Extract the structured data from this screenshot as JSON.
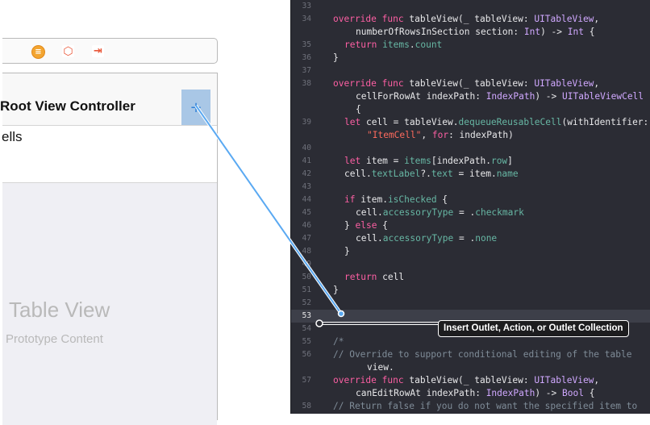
{
  "storyboard": {
    "dock_icons": [
      "view-controller-icon",
      "first-responder-icon",
      "exit-icon"
    ],
    "nav_title": "Root View Controller",
    "add_button_icon": "plus-icon",
    "section_label": "ells",
    "table_view_label": "Table View",
    "prototype_label": "Prototype Content"
  },
  "tooltip": "Insert Outlet, Action, or Outlet Collection",
  "colors": {
    "editor_background": "#2b2c34",
    "keyword": "#fc5fa3",
    "type": "#d0a8ff",
    "property": "#67b7a4",
    "string": "#fc6a5d",
    "comment": "#7f8c98",
    "connection_line": "#5aa9f2",
    "add_button_selected": "#a9c7e6"
  },
  "editor": {
    "current_line": "53",
    "lines": [
      {
        "n": "33",
        "t": ""
      },
      {
        "n": "34",
        "t": "override func tableView(_ tableView: UITableView,"
      },
      {
        "n": "",
        "t": "numberOfRowsInSection section: Int) -> Int {"
      },
      {
        "n": "35",
        "t": "return items.count"
      },
      {
        "n": "36",
        "t": "}"
      },
      {
        "n": "37",
        "t": ""
      },
      {
        "n": "38",
        "t": "override func tableView(_ tableView: UITableView,"
      },
      {
        "n": "",
        "t": "cellForRowAt indexPath: IndexPath) -> UITableViewCell"
      },
      {
        "n": "",
        "t": "{"
      },
      {
        "n": "39",
        "t": "let cell = tableView.dequeueReusableCell(withIdentifier:"
      },
      {
        "n": "",
        "t": "\"ItemCell\", for: indexPath)"
      },
      {
        "n": "40",
        "t": ""
      },
      {
        "n": "41",
        "t": "let item = items[indexPath.row]"
      },
      {
        "n": "42",
        "t": "cell.textLabel?.text = item.name"
      },
      {
        "n": "43",
        "t": ""
      },
      {
        "n": "44",
        "t": "if item.isChecked {"
      },
      {
        "n": "45",
        "t": "cell.accessoryType = .checkmark"
      },
      {
        "n": "46",
        "t": "} else {"
      },
      {
        "n": "47",
        "t": "cell.accessoryType = .none"
      },
      {
        "n": "48",
        "t": "}"
      },
      {
        "n": "49",
        "t": ""
      },
      {
        "n": "50",
        "t": "return cell"
      },
      {
        "n": "51",
        "t": "}"
      },
      {
        "n": "52",
        "t": ""
      },
      {
        "n": "53",
        "t": ""
      },
      {
        "n": "54",
        "t": ""
      },
      {
        "n": "55",
        "t": "/*"
      },
      {
        "n": "56",
        "t": "// Override to support conditional editing of the table"
      },
      {
        "n": "",
        "t": "view."
      },
      {
        "n": "57",
        "t": "override func tableView(_ tableView: UITableView,"
      },
      {
        "n": "",
        "t": "canEditRowAt indexPath: IndexPath) -> Bool {"
      },
      {
        "n": "58",
        "t": "// Return false if you do not want the specified item to"
      }
    ]
  }
}
